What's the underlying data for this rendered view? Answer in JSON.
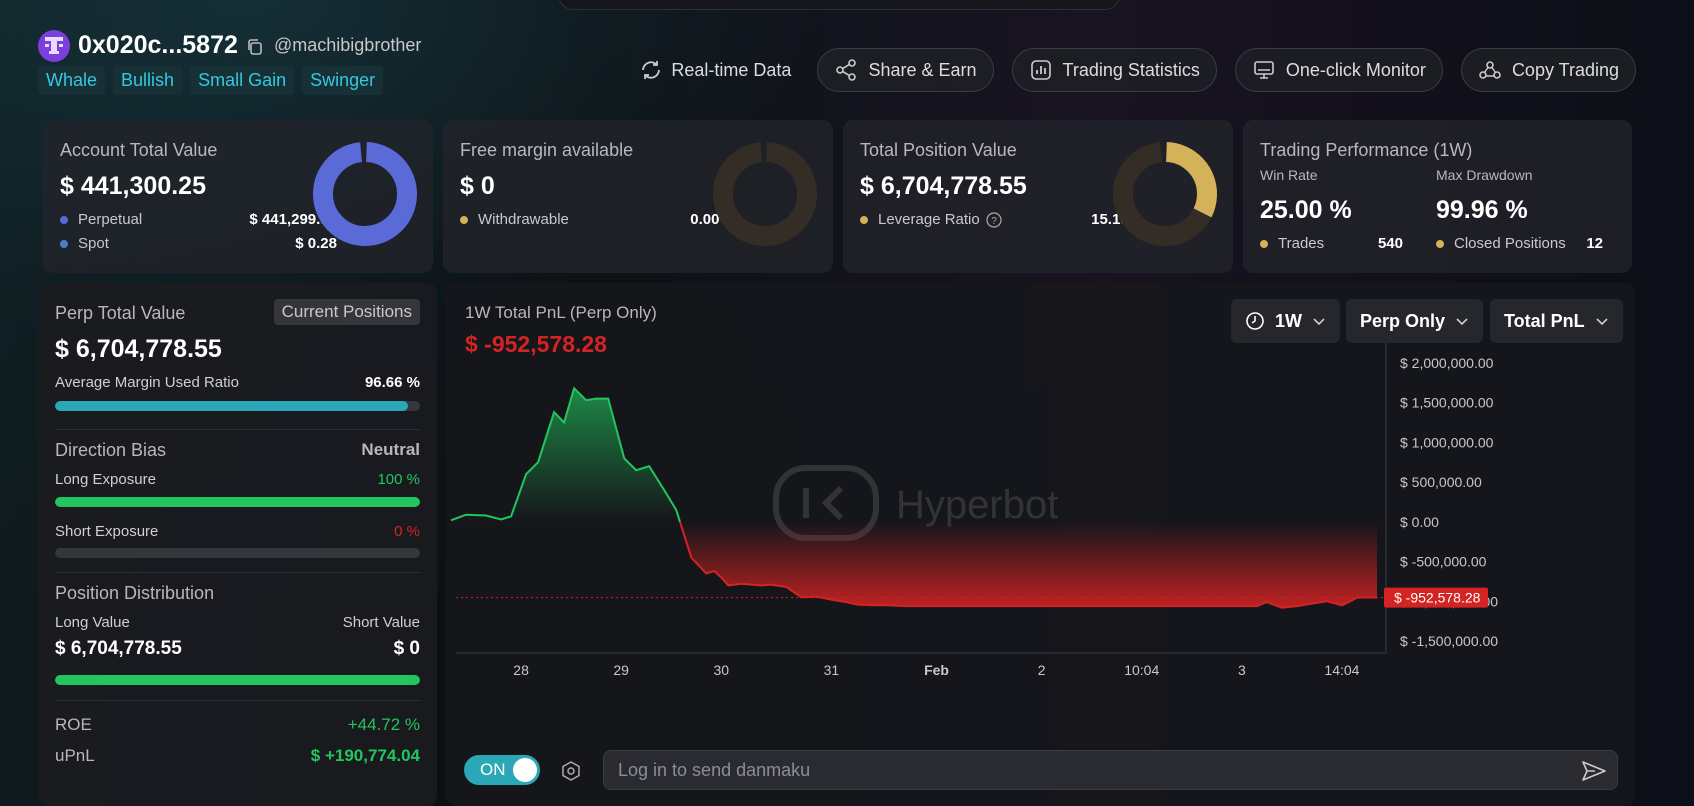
{
  "header": {
    "address": "0x020c...5872",
    "handle": "@machibigbrother",
    "tags": [
      "Whale",
      "Bullish",
      "Small Gain",
      "Swinger"
    ],
    "actions": {
      "realtime": "Real-time Data",
      "share": "Share & Earn",
      "stats": "Trading Statistics",
      "monitor": "One-click Monitor",
      "copy": "Copy Trading"
    }
  },
  "cards": {
    "account": {
      "title": "Account Total Value",
      "value": "$ 441,300.25",
      "perp_label": "Perpetual",
      "perp_value": "$ 441,299.97",
      "spot_label": "Spot",
      "spot_value": "$ 0.28",
      "ring_fraction": 0.999999,
      "colors": {
        "perp": "#5a6bd8",
        "spot": "#4f7cc8"
      }
    },
    "margin": {
      "title": "Free margin available",
      "value": "$ 0",
      "withdraw_label": "Withdrawable",
      "withdraw_value": "0.00 %",
      "ring_fraction": 0
    },
    "position": {
      "title": "Total Position Value",
      "value": "$ 6,704,778.55",
      "lev_label": "Leverage Ratio",
      "lev_value": "15.19x",
      "ring_fraction": 0.3
    },
    "performance": {
      "title": "Trading Performance (1W)",
      "win_label": "Win Rate",
      "win_value": "25.00 %",
      "dd_label": "Max Drawdown",
      "dd_value": "99.96 %",
      "trades_label": "Trades",
      "trades_value": "540",
      "closed_label": "Closed Positions",
      "closed_value": "12"
    }
  },
  "left": {
    "perp_title": "Perp Total Value",
    "current_positions": "Current Positions",
    "perp_value": "$ 6,704,778.55",
    "margin_label": "Average Margin Used Ratio",
    "margin_value": "96.66 %",
    "margin_fraction": 0.9666,
    "bias_label": "Direction Bias",
    "bias_value": "Neutral",
    "long_label": "Long Exposure",
    "long_value": "100 %",
    "long_fraction": 1.0,
    "short_label": "Short Exposure",
    "short_value": "0 %",
    "short_fraction": 0,
    "dist_label": "Position Distribution",
    "long_val_label": "Long Value",
    "short_val_label": "Short Value",
    "long_val": "$ 6,704,778.55",
    "short_val": "$ 0",
    "dist_fraction": 1.0,
    "roe_label": "ROE",
    "roe_value": "+44.72 %",
    "upnl_label": "uPnL",
    "upnl_value": "$ +190,774.04"
  },
  "chart_panel": {
    "title": "1W Total PnL (Perp Only)",
    "pnl": "$ -952,578.28",
    "dropdowns": {
      "period": "1W",
      "scope": "Perp Only",
      "metric": "Total PnL"
    },
    "watermark": "Hyperbot",
    "toggle": "ON",
    "danmaku_placeholder": "Log in to send danmaku"
  },
  "colors": {
    "accent": "#2aa8b8",
    "positive": "#22c55e",
    "negative": "#d42323",
    "tag_text": "#35c8e0",
    "gold": "#d4b25a"
  },
  "chart_data": {
    "type": "area",
    "title": "1W Total PnL (Perp Only)",
    "x_ticks": [
      "28",
      "29",
      "30",
      "31",
      "Feb",
      "2",
      "10:04",
      "3",
      "14:04"
    ],
    "x_tick_pos": [
      0.75,
      1.75,
      2.75,
      3.85,
      4.9,
      5.95,
      6.95,
      7.95,
      8.95
    ],
    "y_ticks": [
      "$ 2,000,000.00",
      "$ 1,500,000.00",
      "$ 1,000,000.00",
      "$ 500,000.00",
      "$ 0.00",
      "$ -500,000.00",
      "$ -1,000,000.00",
      "$ -1,500,000.00"
    ],
    "y_tick_values": [
      2000000,
      1500000,
      1000000,
      500000,
      0,
      -500000,
      -1000000,
      -1500000
    ],
    "ylim": [
      -1650000,
      2250000
    ],
    "xlim": [
      0,
      9.35
    ],
    "current_label": "$ -952,578.28",
    "current_value": -952578.28,
    "x": [
      0.05,
      0.2,
      0.4,
      0.55,
      0.65,
      0.8,
      0.92,
      1.08,
      1.18,
      1.28,
      1.4,
      1.5,
      1.62,
      1.78,
      1.9,
      2.03,
      2.18,
      2.3,
      2.45,
      2.6,
      2.68,
      2.75,
      2.82,
      2.95,
      3.05,
      3.15,
      3.25,
      3.4,
      3.55,
      3.7,
      3.85,
      4.0,
      4.1,
      4.25,
      4.4,
      4.5,
      4.6,
      4.75,
      4.9,
      5.0,
      5.2,
      5.5,
      5.8,
      6.1,
      6.5,
      6.9,
      7.2,
      7.5,
      7.8,
      8.1,
      8.2,
      8.35,
      8.5,
      8.65,
      8.8,
      8.95,
      9.1,
      9.2,
      9.3
    ],
    "y": [
      20000,
      90000,
      80000,
      30000,
      70000,
      600000,
      750000,
      1380000,
      1250000,
      1680000,
      1530000,
      1550000,
      1550000,
      800000,
      650000,
      700000,
      400000,
      150000,
      -450000,
      -650000,
      -620000,
      -700000,
      -800000,
      -780000,
      -790000,
      -800000,
      -790000,
      -820000,
      -950000,
      -940000,
      -980000,
      -1010000,
      -1040000,
      -1050000,
      -1050000,
      -1055000,
      -1060000,
      -1060000,
      -1060000,
      -1060000,
      -1060000,
      -1060000,
      -1060000,
      -1060000,
      -1060000,
      -1060000,
      -1060000,
      -1060000,
      -1060000,
      -1060000,
      -1010000,
      -1080000,
      -1060000,
      -1030000,
      -1000000,
      -1050000,
      -955000,
      -950000,
      -952578
    ]
  }
}
